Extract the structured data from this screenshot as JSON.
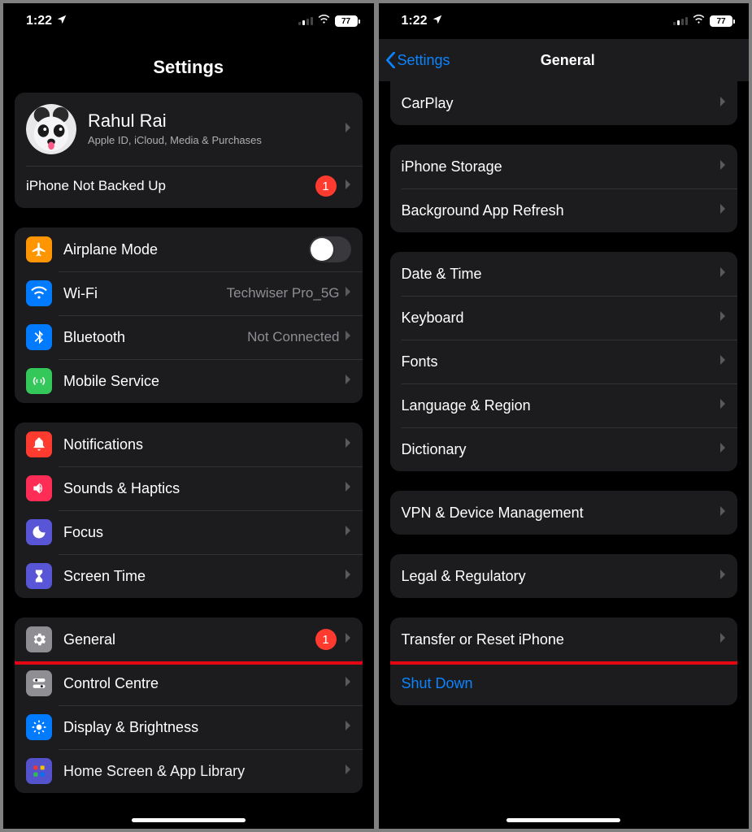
{
  "status": {
    "time": "1:22",
    "battery": "77"
  },
  "left": {
    "title": "Settings",
    "profile": {
      "name": "Rahul Rai",
      "subtitle": "Apple ID, iCloud, Media & Purchases",
      "backup_warning": "iPhone Not Backed Up",
      "backup_badge": "1"
    },
    "network": {
      "airplane": "Airplane Mode",
      "wifi": "Wi-Fi",
      "wifi_value": "Techwiser Pro_5G",
      "bluetooth": "Bluetooth",
      "bluetooth_value": "Not Connected",
      "mobile": "Mobile Service"
    },
    "notif_group": {
      "notifications": "Notifications",
      "sounds": "Sounds & Haptics",
      "focus": "Focus",
      "screentime": "Screen Time"
    },
    "general_group": {
      "general": "General",
      "general_badge": "1",
      "control": "Control Centre",
      "display": "Display & Brightness",
      "home": "Home Screen & App Library"
    }
  },
  "right": {
    "back": "Settings",
    "title": "General",
    "g0": {
      "carplay": "CarPlay"
    },
    "g1": {
      "storage": "iPhone Storage",
      "bgref": "Background App Refresh"
    },
    "g2": {
      "date": "Date & Time",
      "keyboard": "Keyboard",
      "fonts": "Fonts",
      "lang": "Language & Region",
      "dict": "Dictionary"
    },
    "g3": {
      "vpn": "VPN & Device Management"
    },
    "g4": {
      "legal": "Legal & Regulatory"
    },
    "g5": {
      "transfer": "Transfer or Reset iPhone",
      "shutdown": "Shut Down"
    }
  }
}
